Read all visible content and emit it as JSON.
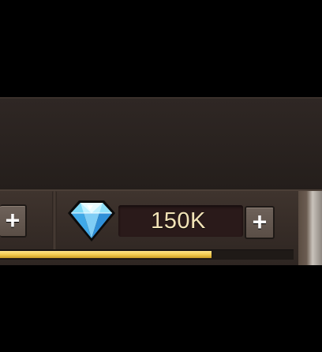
{
  "resources": {
    "gems": {
      "value": "150K",
      "icon": "diamond-icon",
      "add_label": "+"
    },
    "left_resource": {
      "add_label": "+"
    }
  },
  "progress": {
    "fraction": 0.72,
    "color": "#f2c94c"
  },
  "colors": {
    "panel": "#2f2724",
    "bar": "#3f342e",
    "value_text": "#f1e2b6",
    "field_bg": "#2a1a1a"
  }
}
